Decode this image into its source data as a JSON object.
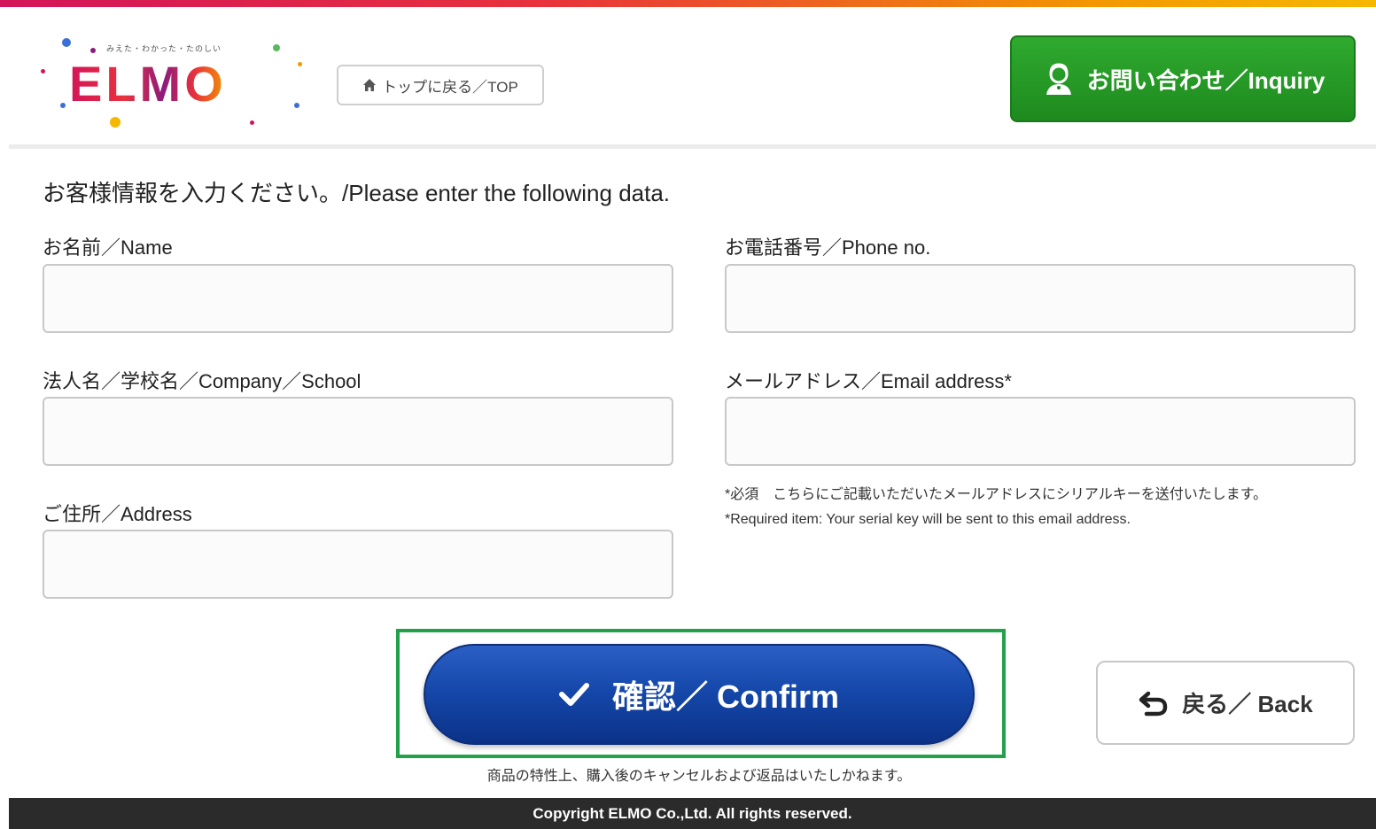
{
  "colors": {
    "accent_stripe": [
      "#d4145a",
      "#f39800"
    ],
    "inquiry_green": "#1e8a1e",
    "confirm_blue": "#1446a8",
    "highlight_green": "#21a24a",
    "footer_bg": "#2b2b2b"
  },
  "header": {
    "logo": {
      "tagline": "みえた・わかった・たのしい",
      "wordmark": "ELMO"
    },
    "top_link": {
      "icon": "home-icon",
      "label": "トップに戻る／TOP"
    },
    "inquiry_button": {
      "icon": "support-person-icon",
      "label": "お問い合わせ／Inquiry"
    }
  },
  "form": {
    "heading": "お客様情報を入力ください。/Please enter the following data.",
    "fields": {
      "name": {
        "label": "お名前／Name",
        "value": "",
        "placeholder": ""
      },
      "company": {
        "label": "法人名／学校名／Company／School",
        "value": "",
        "placeholder": ""
      },
      "address": {
        "label": "ご住所／Address",
        "value": "",
        "placeholder": ""
      },
      "phone": {
        "label": "お電話番号／Phone no.",
        "value": "",
        "placeholder": ""
      },
      "email": {
        "label": "メールアドレス／Email address*",
        "value": "",
        "placeholder": ""
      }
    },
    "email_note_ja": "*必須　こちらにご記載いただいたメールアドレスにシリアルキーを送付いたします。",
    "email_note_en": "*Required item: Your serial key will be sent to this email address."
  },
  "actions": {
    "confirm": {
      "icon": "checkmark-icon",
      "label": "確認／ Confirm"
    },
    "back": {
      "icon": "return-arrow-icon",
      "label": "戻る／ Back"
    },
    "cancel_note": "商品の特性上、購入後のキャンセルおよび返品はいたしかねます。"
  },
  "footer": {
    "copyright": "Copyright ELMO Co.,Ltd. All rights reserved."
  }
}
